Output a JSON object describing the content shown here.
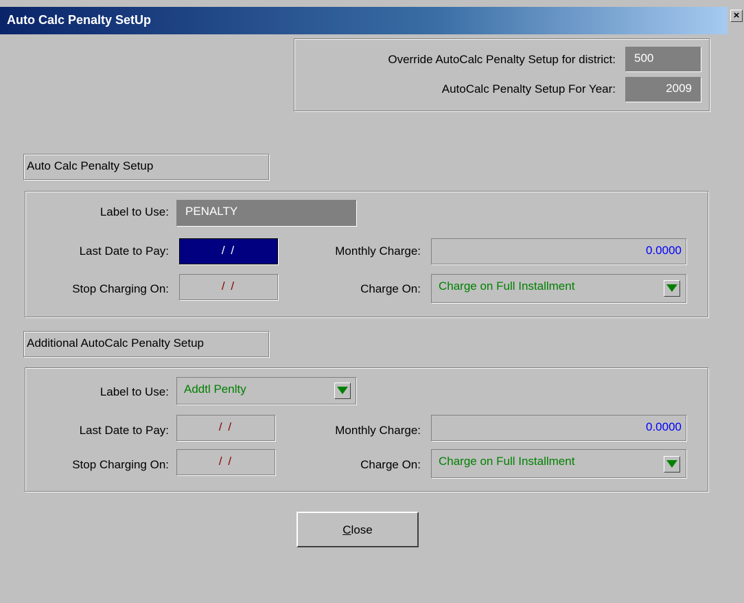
{
  "window": {
    "title": "Auto Calc Penalty SetUp",
    "close_glyph": "×"
  },
  "header": {
    "district_label": "Override AutoCalc Penalty Setup for district:",
    "district_value": "500",
    "year_label": "AutoCalc Penalty Setup For Year:",
    "year_value": "2009"
  },
  "section1": {
    "caption": "Auto Calc Penalty Setup",
    "label_to_use_label": "Label to Use:",
    "label_to_use_value": "PENALTY",
    "last_date_label": "Last Date to Pay:",
    "last_date_value": "/ /",
    "stop_charging_label": "Stop Charging On:",
    "stop_charging_value": "/ /",
    "monthly_charge_label": "Monthly Charge:",
    "monthly_charge_value": "0.0000",
    "charge_on_label": "Charge On:",
    "charge_on_value": "Charge on Full Installment"
  },
  "section2": {
    "caption": "Additional AutoCalc Penalty Setup",
    "label_to_use_label": "Label to Use:",
    "label_to_use_value": "Addtl Penlty",
    "last_date_label": "Last Date to Pay:",
    "last_date_value": "/ /",
    "stop_charging_label": "Stop Charging On:",
    "stop_charging_value": "/ /",
    "monthly_charge_label": "Monthly Charge:",
    "monthly_charge_value": "0.0000",
    "charge_on_label": "Charge On:",
    "charge_on_value": "Charge on Full Installment"
  },
  "footer": {
    "close_first_letter": "C",
    "close_rest": "lose"
  },
  "colors": {
    "title_bar": "#0a246a",
    "window_bg": "#c0c0c0",
    "combo_text": "#008000",
    "numeric_text": "#0000ff",
    "date_text": "#8b0000",
    "active_field": "#000080"
  }
}
